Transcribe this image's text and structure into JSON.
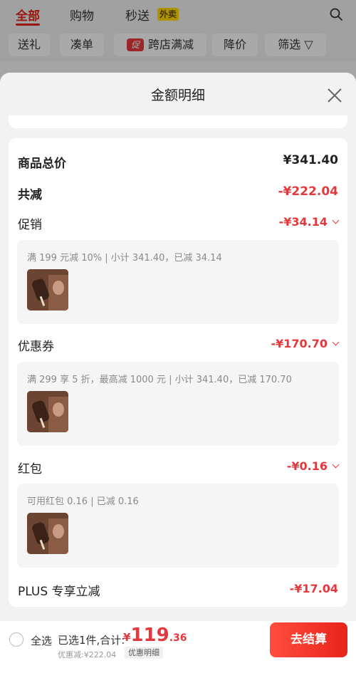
{
  "top_tabs": [
    "全部",
    "购物",
    "秒送"
  ],
  "waimai_badge": "外卖",
  "filters": {
    "gift": "送礼",
    "bundle": "凑单",
    "promo_icon": "促",
    "cross_store": "跨店满减",
    "price_drop": "降价",
    "filter": "筛选"
  },
  "sheet": {
    "title": "金额明细",
    "items_total_label": "商品总价",
    "items_total_value": "¥341.40",
    "total_discount_label": "共减",
    "total_discount_value": "-¥222.04",
    "promo_label": "促销",
    "promo_value": "-¥34.14",
    "promo_detail": "满 199 元减 10% | 小计 341.40，已减 34.14",
    "coupon_label": "优惠券",
    "coupon_value": "-¥170.70",
    "coupon_detail": "满 299 享 5 折，最高减 1000 元 | 小计 341.40，已减 170.70",
    "redpacket_label": "红包",
    "redpacket_value": "-¥0.16",
    "redpacket_detail": "可用红包 0.16 | 已减 0.16",
    "plus_label": "PLUS 专享立减",
    "plus_value": "-¥17.04"
  },
  "bottom": {
    "select_all": "全选",
    "selected_text": "已选1件,合计:",
    "currency": "¥",
    "total_int": "119",
    "total_dec": ".36",
    "discount_text": "优惠减:¥222.04",
    "detail_button": "优惠明细",
    "checkout": "去结算"
  },
  "colors": {
    "accent": "#e4393c",
    "checkout_gradient": [
      "#ff4d3d",
      "#e8231a"
    ],
    "badge": "#ffd700"
  }
}
